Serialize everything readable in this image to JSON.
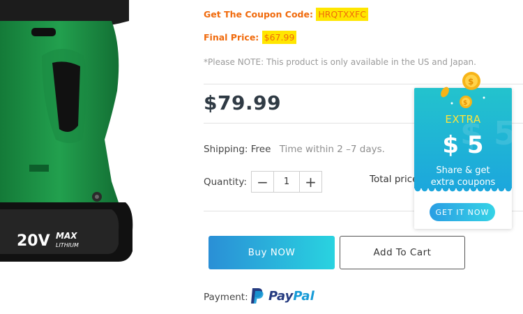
{
  "coupon": {
    "label": "Get The Coupon Code:",
    "code": "HRQTXXFC"
  },
  "final_price": {
    "label": "Final Price:",
    "value": "$67.99"
  },
  "note": "*Please NOTE: This product is only available in the US and Japan.",
  "price": "$79.99",
  "shipping": {
    "label": "Shipping:",
    "value": "Free",
    "time": "Time within 2 –7 days."
  },
  "quantity": {
    "label": "Quantity:",
    "value": "1",
    "minus": "−",
    "plus": "+"
  },
  "total": {
    "label": "Total price"
  },
  "buttons": {
    "buy": "Buy NOW",
    "cart": "Add To Cart"
  },
  "payment": {
    "label": "Payment:",
    "paypal_pay": "Pay",
    "paypal_pal": "Pal"
  },
  "product_image": {
    "battery_voltage": "20V",
    "battery_brand": "MAX",
    "battery_sub": "LITHIUM"
  },
  "promo": {
    "extra": "EXTRA",
    "amount": "$ 5",
    "line1": "Share & get",
    "line2": "extra coupons",
    "cta": "GET IT NOW",
    "ghost_text": "$ 5"
  },
  "colors": {
    "accent_orange": "#f06a0c",
    "highlight": "#ffe600",
    "drill_green": "#1f9a48",
    "promo_teal": "#23c3cd",
    "promo_blue": "#1ca6dd",
    "paypal_dark": "#253b80",
    "paypal_light": "#179bd7"
  }
}
